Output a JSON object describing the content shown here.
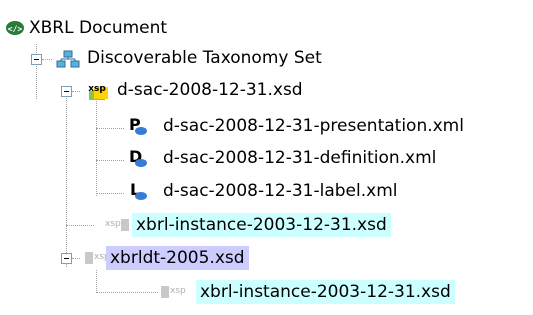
{
  "tree": {
    "root": {
      "label": "XBRL Document",
      "icon": "xbrl-document-icon"
    },
    "dts": {
      "label": "Discoverable Taxonomy Set",
      "icon": "taxonomy-set-icon"
    },
    "schema": {
      "label": "d-sac-2008-12-31.xsd",
      "icon": "xsd-schema-icon"
    },
    "linkbases": [
      {
        "label": "d-sac-2008-12-31-presentation.xml",
        "icon": "presentation-linkbase-icon",
        "letter": "P"
      },
      {
        "label": "d-sac-2008-12-31-definition.xml",
        "icon": "definition-linkbase-icon",
        "letter": "D"
      },
      {
        "label": "d-sac-2008-12-31-label.xml",
        "icon": "label-linkbase-icon",
        "letter": "L"
      }
    ],
    "instance1": {
      "label": "xbrl-instance-2003-12-31.xsd",
      "icon": "xsd-gray-icon"
    },
    "xbrldt": {
      "label": "xbrldt-2005.xsd",
      "icon": "xsd-gray-icon"
    },
    "instance2": {
      "label": "xbrl-instance-2003-12-31.xsd",
      "icon": "xsd-gray-icon"
    },
    "icon_text": "xsp"
  },
  "colors": {
    "highlight_cyan": "#ccffff",
    "highlight_lavender": "#ccccff"
  }
}
